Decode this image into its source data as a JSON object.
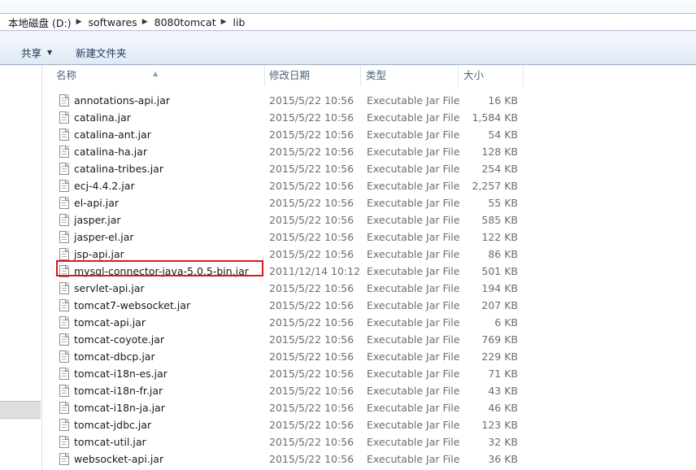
{
  "breadcrumb": [
    "本地磁盘 (D:)",
    "softwares",
    "8080tomcat",
    "lib"
  ],
  "toolbar": {
    "share_label": "共享",
    "new_folder_label": "新建文件夹"
  },
  "columns": {
    "name": "名称",
    "date": "修改日期",
    "type": "类型",
    "size": "大小"
  },
  "files": [
    {
      "name": "annotations-api.jar",
      "date": "2015/5/22 10:56",
      "type": "Executable Jar File",
      "size": "16 KB"
    },
    {
      "name": "catalina.jar",
      "date": "2015/5/22 10:56",
      "type": "Executable Jar File",
      "size": "1,584 KB"
    },
    {
      "name": "catalina-ant.jar",
      "date": "2015/5/22 10:56",
      "type": "Executable Jar File",
      "size": "54 KB"
    },
    {
      "name": "catalina-ha.jar",
      "date": "2015/5/22 10:56",
      "type": "Executable Jar File",
      "size": "128 KB"
    },
    {
      "name": "catalina-tribes.jar",
      "date": "2015/5/22 10:56",
      "type": "Executable Jar File",
      "size": "254 KB"
    },
    {
      "name": "ecj-4.4.2.jar",
      "date": "2015/5/22 10:56",
      "type": "Executable Jar File",
      "size": "2,257 KB"
    },
    {
      "name": "el-api.jar",
      "date": "2015/5/22 10:56",
      "type": "Executable Jar File",
      "size": "55 KB"
    },
    {
      "name": "jasper.jar",
      "date": "2015/5/22 10:56",
      "type": "Executable Jar File",
      "size": "585 KB"
    },
    {
      "name": "jasper-el.jar",
      "date": "2015/5/22 10:56",
      "type": "Executable Jar File",
      "size": "122 KB"
    },
    {
      "name": "jsp-api.jar",
      "date": "2015/5/22 10:56",
      "type": "Executable Jar File",
      "size": "86 KB"
    },
    {
      "name": "mysql-connector-java-5.0.5-bin.jar",
      "date": "2011/12/14 10:12",
      "type": "Executable Jar File",
      "size": "501 KB"
    },
    {
      "name": "servlet-api.jar",
      "date": "2015/5/22 10:56",
      "type": "Executable Jar File",
      "size": "194 KB"
    },
    {
      "name": "tomcat7-websocket.jar",
      "date": "2015/5/22 10:56",
      "type": "Executable Jar File",
      "size": "207 KB"
    },
    {
      "name": "tomcat-api.jar",
      "date": "2015/5/22 10:56",
      "type": "Executable Jar File",
      "size": "6 KB"
    },
    {
      "name": "tomcat-coyote.jar",
      "date": "2015/5/22 10:56",
      "type": "Executable Jar File",
      "size": "769 KB"
    },
    {
      "name": "tomcat-dbcp.jar",
      "date": "2015/5/22 10:56",
      "type": "Executable Jar File",
      "size": "229 KB"
    },
    {
      "name": "tomcat-i18n-es.jar",
      "date": "2015/5/22 10:56",
      "type": "Executable Jar File",
      "size": "71 KB"
    },
    {
      "name": "tomcat-i18n-fr.jar",
      "date": "2015/5/22 10:56",
      "type": "Executable Jar File",
      "size": "43 KB"
    },
    {
      "name": "tomcat-i18n-ja.jar",
      "date": "2015/5/22 10:56",
      "type": "Executable Jar File",
      "size": "46 KB"
    },
    {
      "name": "tomcat-jdbc.jar",
      "date": "2015/5/22 10:56",
      "type": "Executable Jar File",
      "size": "123 KB"
    },
    {
      "name": "tomcat-util.jar",
      "date": "2015/5/22 10:56",
      "type": "Executable Jar File",
      "size": "32 KB"
    },
    {
      "name": "websocket-api.jar",
      "date": "2015/5/22 10:56",
      "type": "Executable Jar File",
      "size": "36 KB"
    }
  ],
  "icons": {
    "file": "jar-file-icon",
    "separator": "chevron-right-icon",
    "dropdown": "dropdown-arrow-icon",
    "sort": "sort-ascending-icon"
  },
  "colors": {
    "highlight_border": "#d7191c",
    "toolbar_text": "#1e395b",
    "secondary_text": "#6d6d6d"
  }
}
